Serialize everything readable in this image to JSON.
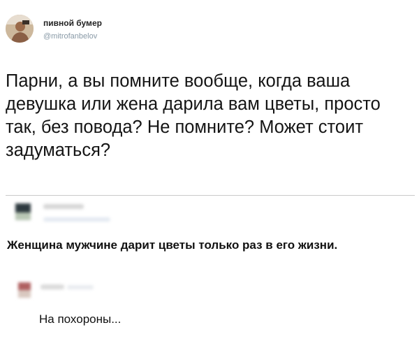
{
  "tweet": {
    "author_name": "пивной бумер",
    "author_handle": "@mitrofanbelov",
    "text": "Парни, а вы помните вообще, когда ваша девушка или жена дарила вам цветы, просто так, без повода? Не помните? Может стоит задуматься?"
  },
  "comments": [
    {
      "text": "Женщина мужчине дарит цветы только раз в его жизни."
    },
    {
      "text": "На похороны..."
    }
  ],
  "icons": {
    "author_avatar": "profile-photo",
    "commenter_avatar": "blurred-avatar"
  }
}
